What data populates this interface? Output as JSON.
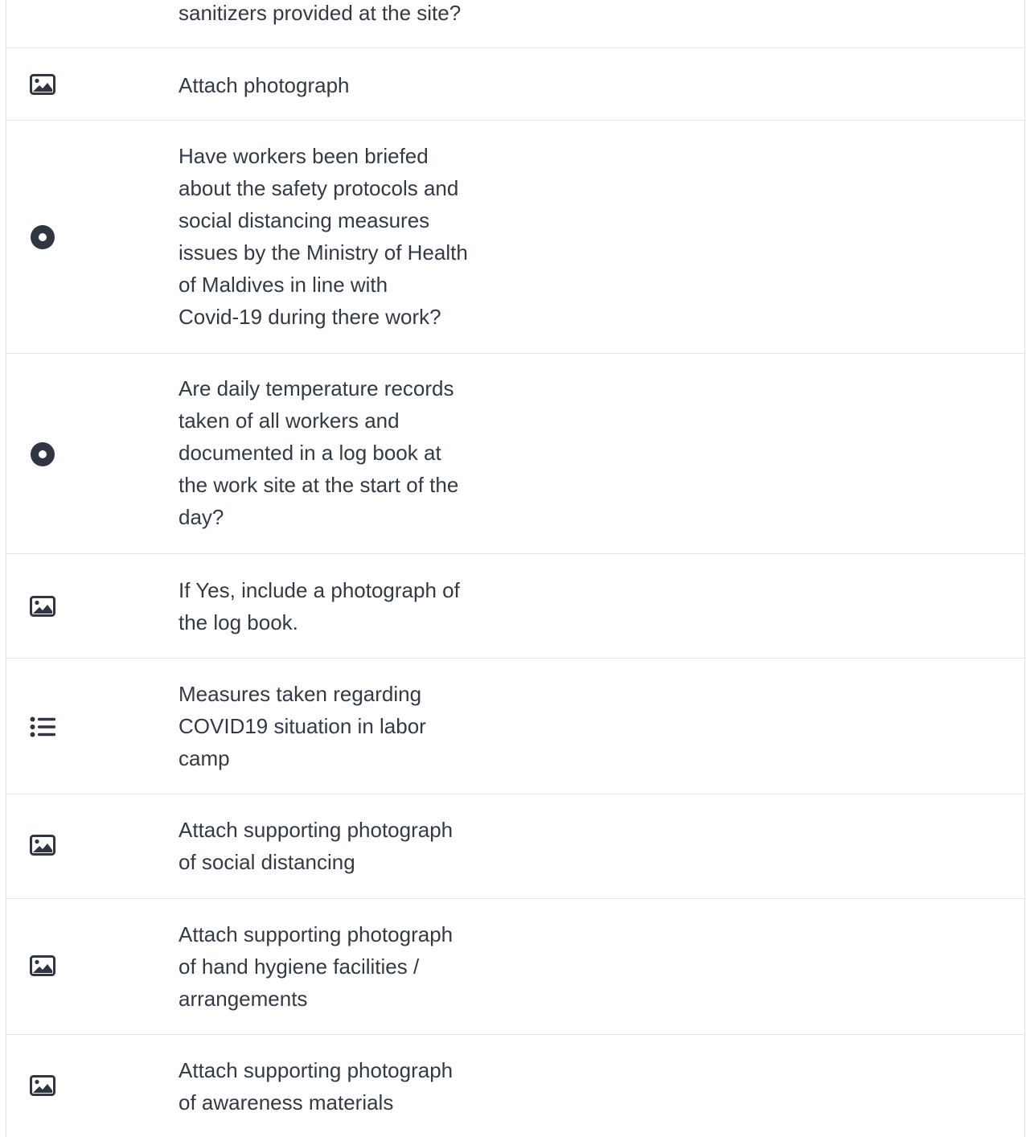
{
  "questions": [
    {
      "type": "radio",
      "icon": "radio-icon",
      "label": "sanitizers provided at the site?"
    },
    {
      "type": "image",
      "icon": "image-icon",
      "label": "Attach photograph"
    },
    {
      "type": "radio",
      "icon": "radio-icon",
      "label_lines": [
        "Have workers been briefed",
        "about the safety protocols and",
        "social distancing measures",
        "issues by the Ministry of Health",
        "of Maldives in line with",
        "Covid-19 during there work?"
      ]
    },
    {
      "type": "radio",
      "icon": "radio-icon",
      "label_lines": [
        "Are daily temperature records",
        "taken of all workers and",
        "documented in a log book at",
        "the work site at the start of the",
        "day?"
      ]
    },
    {
      "type": "image",
      "icon": "image-icon",
      "label_lines": [
        "If Yes, include a photograph of",
        "the log book."
      ]
    },
    {
      "type": "list",
      "icon": "list-icon",
      "label_lines": [
        "Measures taken regarding",
        "COVID19 situation in labor",
        "camp"
      ]
    },
    {
      "type": "image",
      "icon": "image-icon",
      "label_lines": [
        "Attach supporting photograph",
        "of social distancing"
      ]
    },
    {
      "type": "image",
      "icon": "image-icon",
      "label_lines": [
        "Attach supporting photograph",
        "of hand hygiene facilities /",
        "arrangements"
      ]
    },
    {
      "type": "image",
      "icon": "image-icon",
      "label_lines": [
        "Attach supporting photograph",
        "of awareness materials"
      ]
    }
  ],
  "colors": {
    "icon": "#2f3542",
    "divider": "#e2e4e8",
    "text": "#333a45"
  }
}
